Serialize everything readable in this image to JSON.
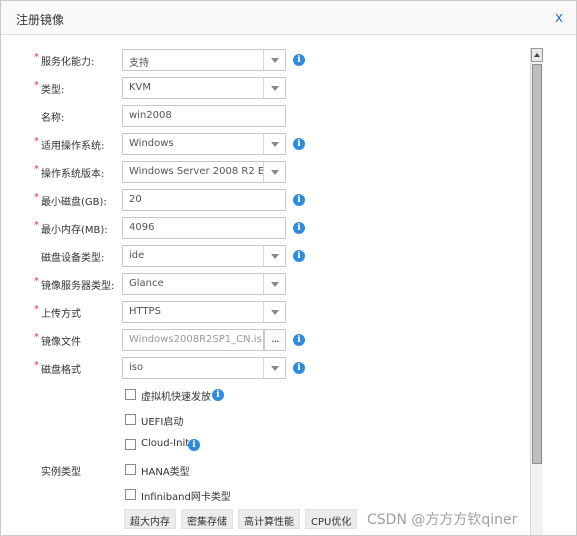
{
  "dialog": {
    "title": "注册镜像",
    "close_label": "x"
  },
  "fields": [
    {
      "id": "service",
      "label": "服务化能力:",
      "required": true,
      "type": "select",
      "value": "支持",
      "info": true
    },
    {
      "id": "type",
      "label": "类型:",
      "required": true,
      "type": "select",
      "value": "KVM",
      "info": false
    },
    {
      "id": "name",
      "label": "名称:",
      "required": false,
      "type": "text",
      "value": "win2008",
      "info": false
    },
    {
      "id": "os",
      "label": "适用操作系统:",
      "required": true,
      "type": "select",
      "value": "Windows",
      "info": true
    },
    {
      "id": "osver",
      "label": "操作系统版本:",
      "required": true,
      "type": "select",
      "value": "Windows Server 2008 R2 E ...",
      "info": false
    },
    {
      "id": "mindisk",
      "label": "最小磁盘(GB):",
      "required": true,
      "type": "text",
      "value": "20",
      "info": true
    },
    {
      "id": "minmem",
      "label": "最小内存(MB):",
      "required": true,
      "type": "text",
      "value": "4096",
      "info": true
    },
    {
      "id": "diskdev",
      "label": "磁盘设备类型:",
      "required": false,
      "type": "select",
      "value": "ide",
      "info": true
    },
    {
      "id": "imgsrv",
      "label": "镜像服务器类型:",
      "required": true,
      "type": "select",
      "value": "Glance",
      "info": false
    },
    {
      "id": "upload",
      "label": "上传方式",
      "required": true,
      "type": "select",
      "value": "HTTPS",
      "info": false
    },
    {
      "id": "file",
      "label": "镜像文件",
      "required": true,
      "type": "file",
      "value": "Windows2008R2SP1_CN.is",
      "info": true,
      "browse_label": "..."
    },
    {
      "id": "diskfmt",
      "label": "磁盘格式",
      "required": true,
      "type": "select",
      "value": "iso",
      "info": true
    }
  ],
  "checkboxes": [
    {
      "label": "虚拟机快速发放",
      "info": true
    },
    {
      "label": "UEFI启动",
      "info": false
    },
    {
      "label": "Cloud-Init",
      "info": true
    }
  ],
  "instance_type": {
    "label": "实例类型",
    "options": [
      "HANA类型",
      "Infiniband网卡类型"
    ],
    "tags": [
      "超大内存",
      "密集存储",
      "高计算性能",
      "CPU优化"
    ]
  },
  "info_glyph": "i",
  "watermark": "CSDN @方方方钦qiner",
  "colors": {
    "accent": "#2f8ae0",
    "required": "#e03a3a"
  }
}
